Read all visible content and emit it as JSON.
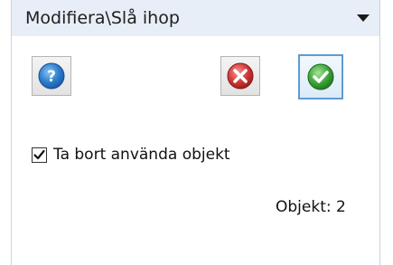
{
  "header": {
    "title": "Modifiera\\Slå ihop",
    "collapse_icon": "chevron-down-icon"
  },
  "buttons": {
    "help_icon": "help-icon",
    "cancel_icon": "cancel-icon",
    "ok_icon": "ok-check-icon"
  },
  "option": {
    "label": "Ta bort använda objekt",
    "checked": true
  },
  "status": {
    "count_label": "Objekt: 2"
  },
  "colors": {
    "header_bg": "#e8eef7",
    "help_blue": "#2f7fcf",
    "cancel_red": "#d23a3a",
    "ok_green": "#3fa83a",
    "primary_border": "#5f9bd3"
  }
}
